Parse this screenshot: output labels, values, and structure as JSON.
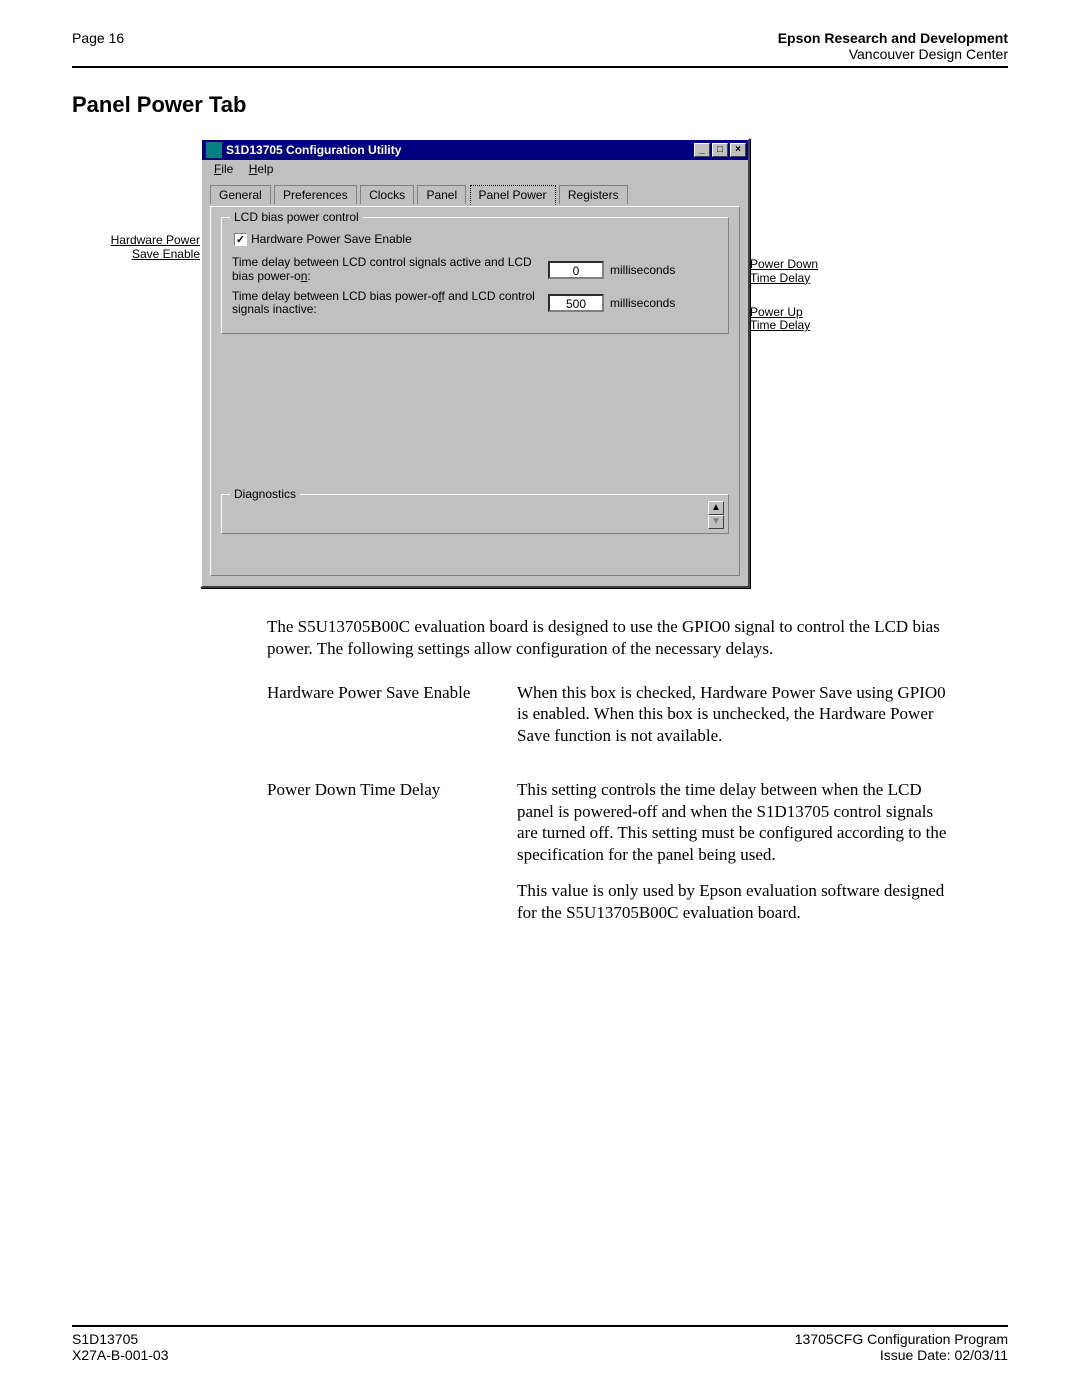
{
  "header": {
    "page_label": "Page 16",
    "org_bold": "Epson Research and Development",
    "org_sub": "Vancouver Design Center"
  },
  "section_title": "Panel Power Tab",
  "callouts": {
    "left_line1": "Hardware Power",
    "left_line2": "Save Enable",
    "right_pd_line1": "Power Down",
    "right_pd_line2": "Time Delay",
    "right_pu_line1": "Power Up",
    "right_pu_line2": "Time Delay"
  },
  "window": {
    "title": "S1D13705 Configuration Utility",
    "menu": {
      "file": "File",
      "file_u": "F",
      "help": "Help",
      "help_u": "H"
    },
    "tabs": [
      "General",
      "Preferences",
      "Clocks",
      "Panel",
      "Panel Power",
      "Registers"
    ],
    "active_tab": 4,
    "group_title": "LCD bias power control",
    "checkbox_label": "Hardware Power Save Enable",
    "checkbox_checked": "✓",
    "delay1_label_a": "Time delay between LCD control signals active and LCD bias power-o",
    "delay1_label_u": "n",
    "delay1_label_b": ":",
    "delay1_value": "0",
    "delay2_label_a": "Time delay between LCD bias power-o",
    "delay2_label_u": "f",
    "delay2_label_b": "f and LCD control signals inactive:",
    "delay2_value": "500",
    "unit": "milliseconds",
    "diag_title": "Diagnostics",
    "winbtn_min": "_",
    "winbtn_max": "□",
    "winbtn_close": "×",
    "scroll_up": "▲",
    "scroll_down": "▼"
  },
  "body": {
    "intro": "The S5U13705B00C evaluation board is designed to use the GPIO0 signal to control the LCD bias power. The following settings allow configuration of the necessary delays.",
    "defs": [
      {
        "term": "Hardware Power Save Enable",
        "desc1": "When this box is checked, Hardware Power Save using GPIO0 is enabled. When this box is unchecked, the Hardware Power Save function is not available."
      },
      {
        "term": "Power Down Time Delay",
        "desc1": "This setting controls the time delay between when the LCD panel is powered-off and when the S1D13705 control signals are turned off. This setting must be configured according to the specification for the panel being used.",
        "desc2": "This value is only used by Epson evaluation software designed for the S5U13705B00C evaluation board."
      }
    ]
  },
  "footer": {
    "l1": "S1D13705",
    "l2": "X27A-B-001-03",
    "r1": "13705CFG Configuration Program",
    "r2": "Issue Date: 02/03/11"
  }
}
